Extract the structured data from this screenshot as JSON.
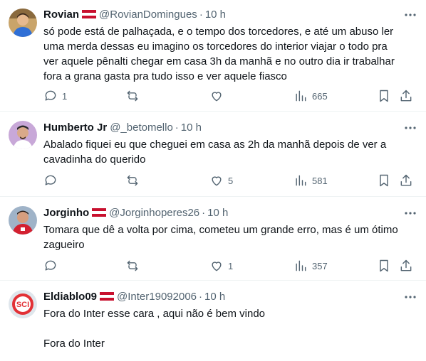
{
  "tweets": [
    {
      "name": "Rovian",
      "handle": "@RovianDomingues",
      "time": "10 h",
      "text": "só pode está de palhaçada, e o tempo dos torcedores, e até um abuso ler\numa merda dessas eu imagino os torcedores do interior viajar o todo pra\nver aquele pênalti chegar em casa 3h da manhã e no outro dia ir trabalhar\nfora a grana gasta pra tudo isso e ver aquele fiasco",
      "reply_count": "1",
      "retweet_count": "",
      "like_count": "",
      "view_count": "665"
    },
    {
      "name": "Humberto Jr",
      "handle": "@_betomello",
      "time": "10 h",
      "text": "Abalado fiquei eu que cheguei em casa as 2h da manhã depois de ver a\ncavadinha do querido",
      "reply_count": "",
      "retweet_count": "",
      "like_count": "5",
      "view_count": "581"
    },
    {
      "name": "Jorginho",
      "handle": "@Jorginhoperes26",
      "time": "10 h",
      "text": "Tomara que dê a volta por cima, cometeu um grande erro, mas é um ótimo\nzagueiro",
      "reply_count": "",
      "retweet_count": "",
      "like_count": "1",
      "view_count": "357"
    },
    {
      "name": "Eldiablo09",
      "handle": "@Inter19092006",
      "time": "10 h",
      "text": "Fora do Inter esse cara , aqui não é bem vindo\n\nFora do Inter",
      "reply_count": "",
      "retweet_count": "",
      "like_count": "",
      "view_count": ""
    }
  ],
  "ui": {
    "dot": "·"
  },
  "colors": {
    "text": "#0f1419",
    "secondary": "#536471",
    "divider": "#eff3f4",
    "flag_red": "#c8102e"
  },
  "icons": [
    "reply-icon",
    "retweet-icon",
    "like-icon",
    "views-icon",
    "bookmark-icon",
    "share-icon",
    "more-icon",
    "austria-flag-icon"
  ]
}
